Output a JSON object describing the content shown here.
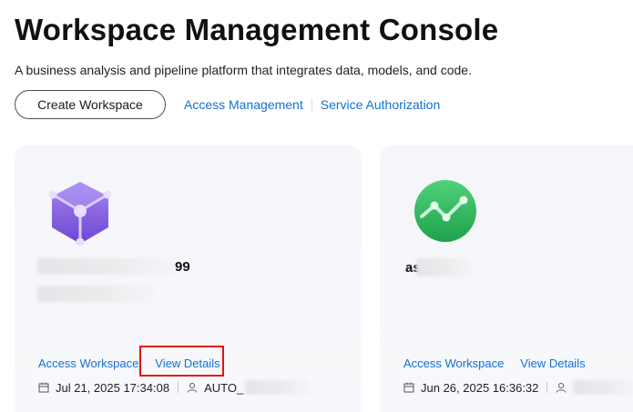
{
  "header": {
    "title": "Workspace Management Console",
    "subtitle": "A business analysis and pipeline platform that integrates data, models, and code."
  },
  "actions": {
    "create_label": "Create Workspace",
    "access_management": "Access Management",
    "service_authorization": "Service Authorization"
  },
  "cards": [
    {
      "logo": "purple-cube-icon",
      "name_suffix": "99",
      "access_label": "Access Workspace",
      "details_label": "View Details",
      "date": "Jul 21, 2025 17:34:08",
      "owner": "AUTO_"
    },
    {
      "logo": "green-chart-icon",
      "name_suffix": "as",
      "access_label": "Access Workspace",
      "details_label": "View Details",
      "date": "Jun 26, 2025 16:36:32",
      "owner": ""
    }
  ],
  "colors": {
    "link": "#1470d6",
    "highlight": "#e31313",
    "purple": "#8a5fe3",
    "green": "#2dbb5d"
  }
}
